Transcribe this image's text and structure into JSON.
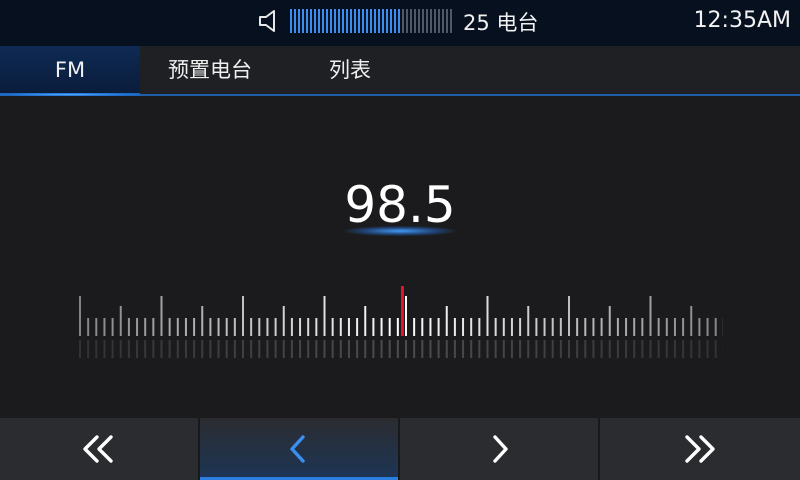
{
  "status": {
    "volume_icon": "speaker-icon",
    "volume_level": 0.68,
    "volume_ticks_total": 41,
    "station_count_text": "25 电台",
    "time": "12:35AM"
  },
  "tabs": [
    {
      "label": "FM",
      "active": true
    },
    {
      "label": "预置电台",
      "active": false
    },
    {
      "label": "列表",
      "active": false
    }
  ],
  "tuner": {
    "frequency": "98.5",
    "indicator_color": "#e0162b"
  },
  "controls": [
    {
      "name": "seek-back-button",
      "icon": "double-chevron-left-icon",
      "active": false
    },
    {
      "name": "step-back-button",
      "icon": "chevron-left-icon",
      "active": true
    },
    {
      "name": "step-forward-button",
      "icon": "chevron-right-icon",
      "active": false
    },
    {
      "name": "seek-forward-button",
      "icon": "double-chevron-right-icon",
      "active": false
    }
  ],
  "colors": {
    "accent": "#2c7de0",
    "volume_on": "#3b8ef0",
    "background": "#1b1b1d"
  }
}
